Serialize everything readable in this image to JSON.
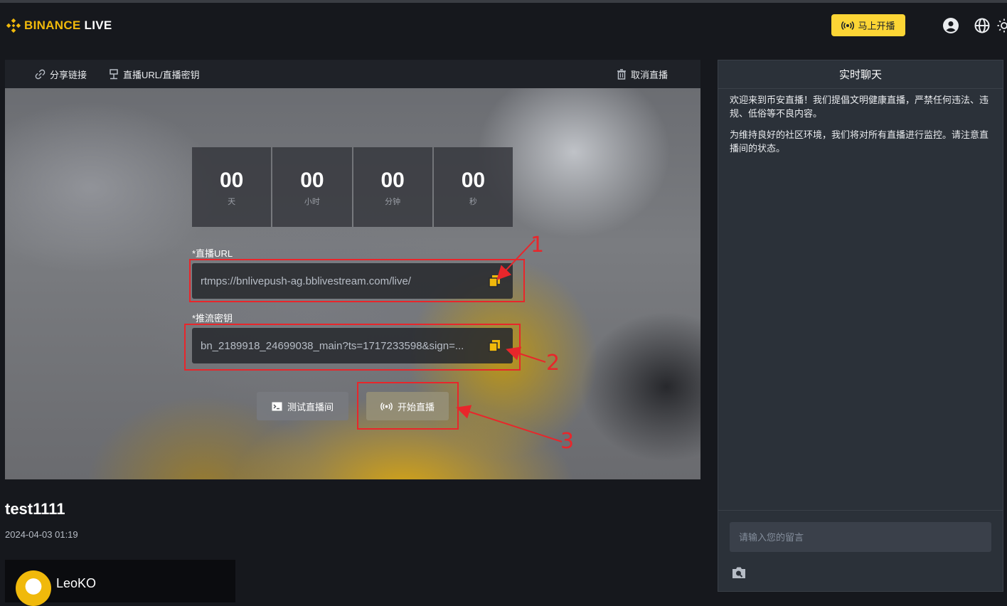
{
  "header": {
    "logo_brand": "BINANCE",
    "logo_live": "LIVE",
    "golive_label": "马上开播",
    "icons": [
      "user-icon",
      "globe-icon",
      "sun-icon"
    ]
  },
  "toolbar": {
    "share_label": "分享链接",
    "url_key_label": "直播URL/直播密钥",
    "cancel_label": "取消直播"
  },
  "countdown": [
    {
      "value": "00",
      "unit": "天"
    },
    {
      "value": "00",
      "unit": "小时"
    },
    {
      "value": "00",
      "unit": "分钟"
    },
    {
      "value": "00",
      "unit": "秒"
    }
  ],
  "stream_url": {
    "label": "*直播URL",
    "value": "rtmps://bnlivepush-ag.bblivestream.com/live/"
  },
  "stream_key": {
    "label": "*推流密钥",
    "value": "bn_2189918_24699038_main?ts=1717233598&sign=..."
  },
  "buttons": {
    "test_label": "测试直播间",
    "start_label": "开始直播"
  },
  "annotations": [
    "1",
    "2",
    "3"
  ],
  "stream": {
    "title": "test1111",
    "date": "2024-04-03 01:19"
  },
  "profile": {
    "name": "LeoKO"
  },
  "chat": {
    "title": "实时聊天",
    "messages": [
      "欢迎来到币安直播！我们提倡文明健康直播，严禁任何违法、违规、低俗等不良内容。",
      "为维持良好的社区环境，我们将对所有直播进行监控。请注意直播间的状态。"
    ],
    "input_placeholder": "请输入您的留言"
  },
  "colors": {
    "accent": "#fcd535",
    "brand": "#f0b90b",
    "annotation": "#e8262b",
    "panel": "#2b3139"
  }
}
